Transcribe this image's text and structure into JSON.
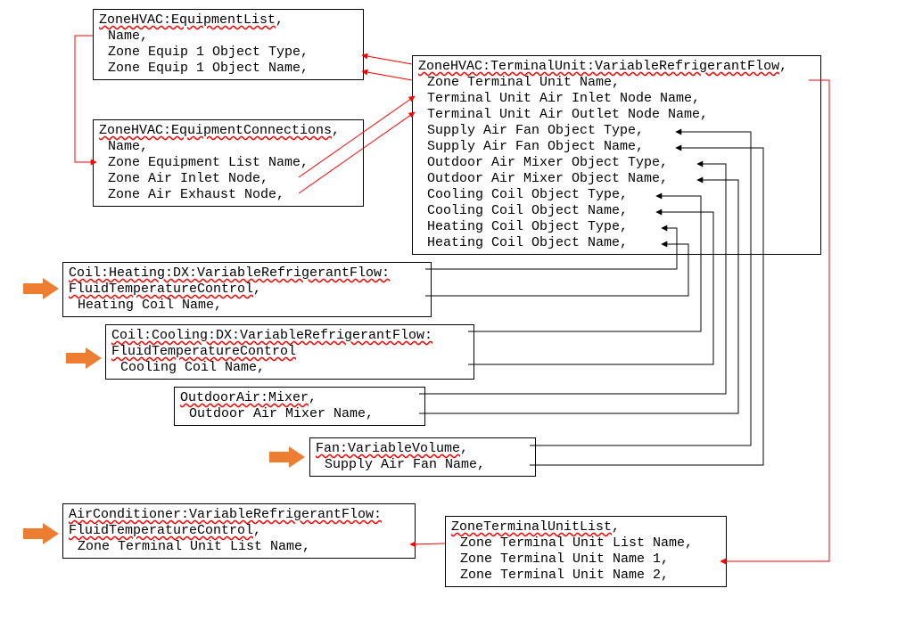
{
  "boxes": {
    "equipList": {
      "title": "ZoneHVAC:EquipmentList",
      "f1": "Name,",
      "f2": "Zone Equip 1 Object Type,",
      "f3": "Zone Equip 1 Object Name,"
    },
    "equipConn": {
      "title": "ZoneHVAC:EquipmentConnections",
      "f1": "Name,",
      "f2": "Zone Equipment List Name,",
      "f3": "Zone Air Inlet Node,",
      "f4": "Zone Air Exhaust Node,"
    },
    "terminalUnit": {
      "title": "ZoneHVAC:TerminalUnit:VariableRefrigerantFlow",
      "f1": "Zone Terminal Unit Name,",
      "f2": "Terminal Unit Air Inlet Node Name,",
      "f3": "Terminal Unit Air Outlet Node Name,",
      "f4": "Supply Air Fan Object Type,",
      "f5": "Supply Air Fan Object Name,",
      "f6": "Outdoor Air Mixer Object Type,",
      "f7": "Outdoor Air Mixer Object Name,",
      "f8": "Cooling Coil Object Type,",
      "f9": "Cooling Coil Object Name,",
      "f10": "Heating Coil Object Type,",
      "f11": "Heating Coil Object Name,"
    },
    "heatingCoil": {
      "title1": "Coil:Heating:DX:VariableRefrigerantFlow:",
      "title2": "FluidTemperatureControl",
      "f1": "Heating Coil Name,"
    },
    "coolingCoil": {
      "title1": "Coil:Cooling:DX:VariableRefrigerantFlow:",
      "title2": "FluidTemperatureControl",
      "f1": "Cooling Coil Name,"
    },
    "oaMixer": {
      "title": "OutdoorAir:Mixer",
      "f1": "Outdoor Air Mixer Name,"
    },
    "fan": {
      "title": "Fan:VariableVolume",
      "f1": "Supply Air Fan Name,"
    },
    "acVRF": {
      "title1": "AirConditioner:VariableRefrigerantFlow:",
      "title2": "FluidTemperatureControl",
      "f1": "Zone Terminal Unit List Name,"
    },
    "ztuList": {
      "title": "ZoneTerminalUnitList",
      "f1": "Zone Terminal Unit List Name,",
      "f2": "Zone Terminal Unit Name 1,",
      "f3": "Zone Terminal Unit Name 2,"
    }
  }
}
